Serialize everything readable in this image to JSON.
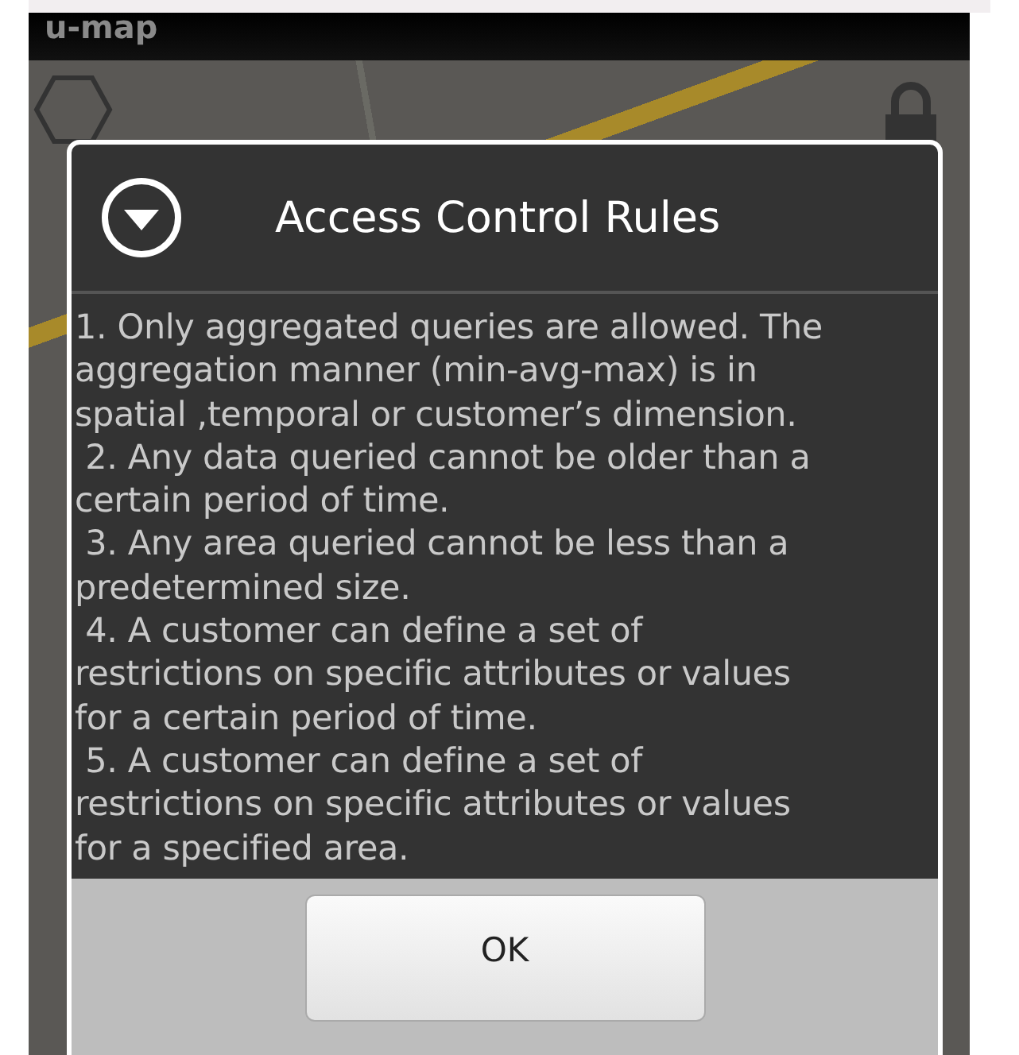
{
  "app_bar": {
    "title": "u-map"
  },
  "dialog": {
    "title": "Access Control Rules",
    "message_lines": [
      "1. Only aggregated queries are allowed. The",
      "aggregation manner (min-avg-max) is in",
      "spatial ,temporal or customer’s dimension.",
      " 2. Any data queried cannot be older than a",
      "certain period of time.",
      " 3. Any area queried cannot be less than a",
      "predetermined size.",
      " 4. A customer can define a set of",
      "restrictions on specific attributes or values",
      "for a certain period of time.",
      " 5. A customer can define a set of",
      "restrictions on specific attributes or values",
      "for a specified area."
    ],
    "buttons": [
      "OK"
    ]
  }
}
